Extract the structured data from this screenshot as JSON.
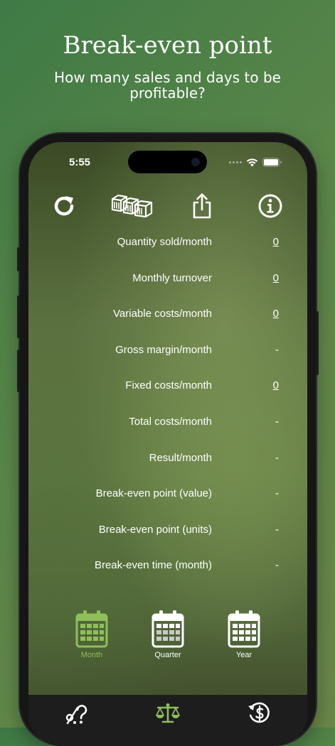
{
  "header": {
    "title": "Break-even point",
    "subtitle": "How many sales and days to be profitable?"
  },
  "status_bar": {
    "time": "5:55"
  },
  "toolbar": {
    "icons": [
      "refresh-icon",
      "boxes-icon",
      "share-icon",
      "info-icon"
    ]
  },
  "rows": [
    {
      "label": "Quantity sold/month",
      "value": "0",
      "editable": true
    },
    {
      "label": "Monthly turnover",
      "value": "0",
      "editable": true
    },
    {
      "label": "Variable costs/month",
      "value": "0",
      "editable": true
    },
    {
      "label": "Gross margin/month",
      "value": "-",
      "editable": false
    },
    {
      "label": "Fixed costs/month",
      "value": "0",
      "editable": true
    },
    {
      "label": "Total costs/month",
      "value": "-",
      "editable": false
    },
    {
      "label": "Result/month",
      "value": "-",
      "editable": false
    },
    {
      "label": "Break-even point (value)",
      "value": "-",
      "editable": false
    },
    {
      "label": "Break-even point (units)",
      "value": "-",
      "editable": false
    },
    {
      "label": "Break-even time (month)",
      "value": "-",
      "editable": false
    }
  ],
  "periods": [
    {
      "label": "Month",
      "active": true
    },
    {
      "label": "Quarter",
      "active": false
    },
    {
      "label": "Year",
      "active": false
    }
  ],
  "colors": {
    "accent": "#8fbf5a",
    "tabbar": "#1d1d1d",
    "text": "#ffffff"
  },
  "tabs": [
    {
      "icon": "percent-icon",
      "active": false
    },
    {
      "icon": "balance-scale-icon",
      "active": true
    },
    {
      "icon": "dollar-refresh-icon",
      "active": false
    }
  ]
}
